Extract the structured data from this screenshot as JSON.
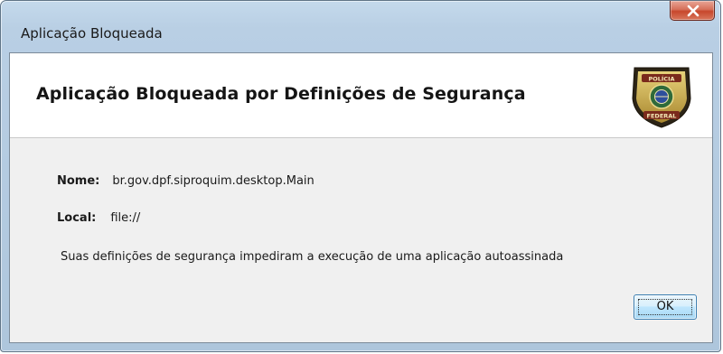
{
  "window": {
    "title": "Aplicação Bloqueada"
  },
  "dialog": {
    "heading": "Aplicação Bloqueada por Definições de Segurança",
    "badge_icon": "policia-federal-badge-icon",
    "badge_text_top": "POLÍCIA",
    "badge_text_bottom": "FEDERAL",
    "fields": {
      "name_label": "Nome:",
      "name_value": "br.gov.dpf.siproquim.desktop.Main",
      "local_label": "Local:",
      "local_value": "file://"
    },
    "message": "Suas definições de segurança impediram a execução de uma aplicação autoassinada",
    "ok_label": "OK"
  },
  "colors": {
    "close_button": "#c7472c",
    "frame": "#b9cfe4",
    "ok_button_border": "#3c7fb1"
  }
}
